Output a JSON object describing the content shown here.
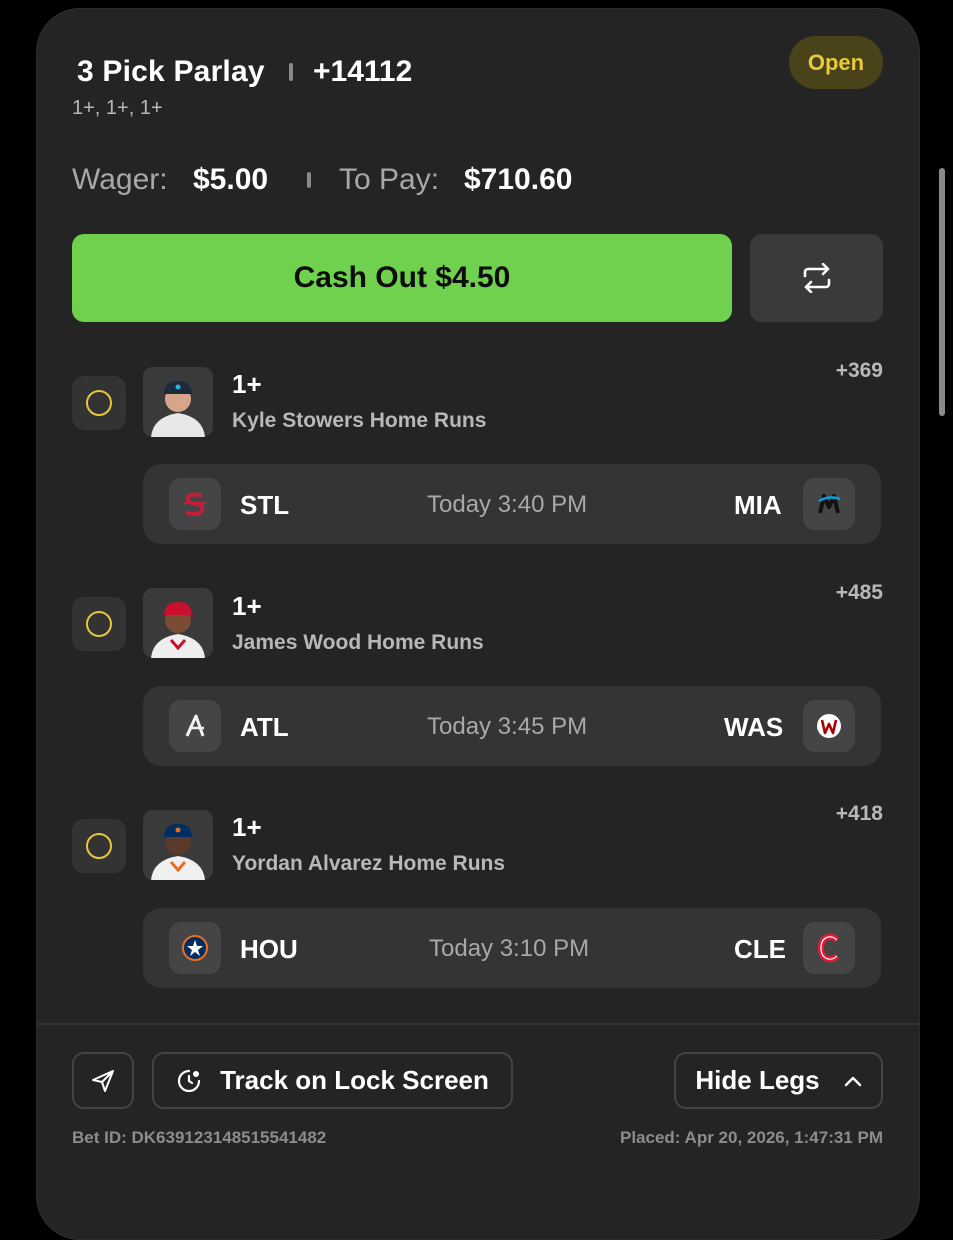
{
  "bet": {
    "title": "3 Pick Parlay",
    "odds": "+14112",
    "summary": "1+, 1+, 1+",
    "status": "Open",
    "wager_label": "Wager:",
    "wager_value": "$5.00",
    "topay_label": "To Pay:",
    "topay_value": "$710.60",
    "cashout_label": "Cash Out $4.50"
  },
  "legs": [
    {
      "pick": "1+",
      "market": "Kyle Stowers Home Runs",
      "odds": "+369",
      "away": "STL",
      "home": "MIA",
      "time": "Today 3:40 PM",
      "away_logo": "cardinals-logo",
      "home_logo": "marlins-logo"
    },
    {
      "pick": "1+",
      "market": "James Wood Home Runs",
      "odds": "+485",
      "away": "ATL",
      "home": "WAS",
      "time": "Today 3:45 PM",
      "away_logo": "braves-logo",
      "home_logo": "nationals-logo"
    },
    {
      "pick": "1+",
      "market": "Yordan Alvarez Home Runs",
      "odds": "+418",
      "away": "HOU",
      "home": "CLE",
      "time": "Today 3:10 PM",
      "away_logo": "astros-logo",
      "home_logo": "guardians-logo"
    }
  ],
  "footer": {
    "track_label": "Track on Lock Screen",
    "hide_legs_label": "Hide Legs",
    "bet_id": "Bet ID: DK639123148515541482",
    "placed": "Placed: Apr 20, 2026, 1:47:31 PM"
  },
  "colors": {
    "accent_green": "#6fd14d",
    "open_yellow": "#e9c83a",
    "card_bg": "#242424",
    "page_bg": "#000000"
  }
}
